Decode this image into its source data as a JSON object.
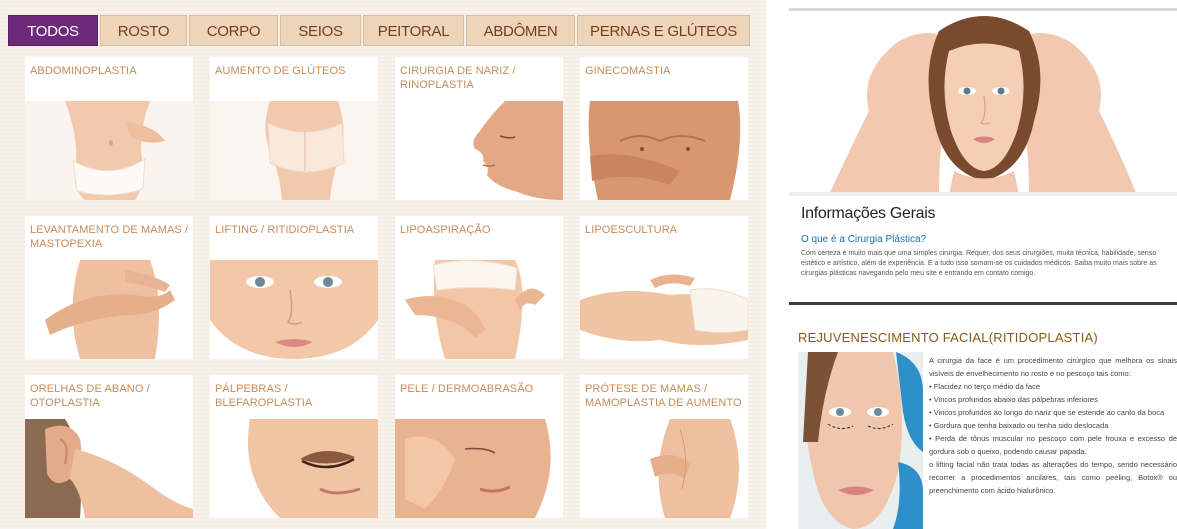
{
  "tabs": [
    {
      "label": "TODOS",
      "active": true
    },
    {
      "label": "ROSTO",
      "active": false
    },
    {
      "label": "CORPO",
      "active": false
    },
    {
      "label": "SEIOS",
      "active": false
    },
    {
      "label": "PEITORAL",
      "active": false
    },
    {
      "label": "ABDÔMEN",
      "active": false
    },
    {
      "label": "PERNAS E GLÚTEOS",
      "active": false
    }
  ],
  "procedures": [
    {
      "label": "ABDOMINOPLASTIA",
      "image": "abdomen-photo"
    },
    {
      "label": "AUMENTO DE GLÚTEOS",
      "image": "glutes-photo"
    },
    {
      "label": "CIRURGIA DE NARIZ / RINOPLASTIA",
      "image": "nose-profile-photo"
    },
    {
      "label": "GINECOMASTIA",
      "image": "male-chest-photo"
    },
    {
      "label": "LEVANTAMENTO DE MAMAS / MASTOPEXIA",
      "image": "breast-lift-photo"
    },
    {
      "label": "LIFTING / RITIDIOPLASTIA",
      "image": "face-lifting-photo"
    },
    {
      "label": "LIPOASPIRAÇÃO",
      "image": "liposuction-photo"
    },
    {
      "label": "LIPOESCULTURA",
      "image": "lying-body-photo"
    },
    {
      "label": "ORELHAS DE ABANO / OTOPLASTIA",
      "image": "ear-photo"
    },
    {
      "label": "PÁLPEBRAS / BLEFAROPLASTIA",
      "image": "eyelid-photo"
    },
    {
      "label": "PELE / DERMOABRASÃO",
      "image": "skin-photo"
    },
    {
      "label": "PRÓTESE DE MAMAS / MAMOPLASTIA DE AUMENTO",
      "image": "breast-implant-photo"
    }
  ],
  "info": {
    "title": "Informações Gerais",
    "subtitle": "O que é a Cirurgia Plástica?",
    "body": "Com certeza é muito mais que uma simples cirurgia. Requer, dos seus cirurgiões, muita técnica, habilidade, senso estético e artístico, além de experiência. E a tudo isso somam-se os cuidados médicos. Saiba muito mais sobre as cirurgias plásticas navegando pelo meu site e entrando em contato comigo."
  },
  "rejuvenation": {
    "title": "REJUVENESCIMENTO FACIAL(RITIDOPLASTIA)",
    "paragraphs": [
      "A cirurgia da face é um procedimento cirúrgico que melhora os sinais visíveis de envelhecimento no rosto e no pescoço tais como:",
      "• Flacidez no terço médio da face",
      "• Vincos profundos abaixo das pálpebras inferiores",
      "• Vincos profundos ao longo do nariz que se estende ao canto da boca",
      "• Gordura que tenha baixado ou tenha sido deslocada",
      "• Perda de tônus muscular no pescoço com pele frouxa e excesso de gordura sob o queixo, podendo causar papada.",
      "o lifting facial não trata todas as alterações do tempo, sendo necessário recorrer a procedimentos ancilares, tais como peeling, Botox® ou preenchimento com ácido hialurônico."
    ]
  },
  "colors": {
    "tab_active": "#6d2a7a",
    "tab_inactive": "#ecd5b9",
    "tab_text": "#7a3b1d",
    "card_label": "#c78b5a",
    "link_blue": "#1a6fa3",
    "rejuv_title": "#8a5a14",
    "skin": "#f2c9ad"
  }
}
